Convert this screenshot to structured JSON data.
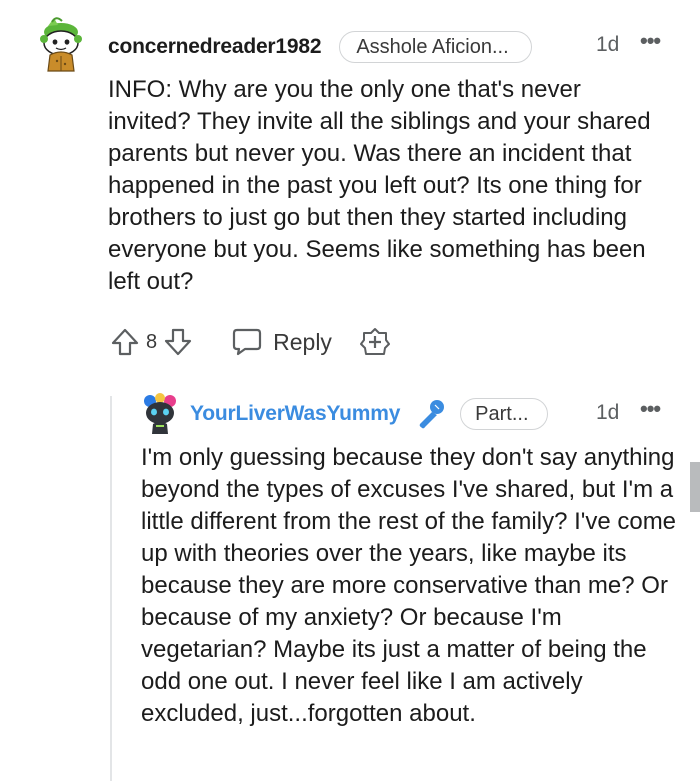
{
  "comment": {
    "username": "concernedreader1982",
    "flair": "Asshole Aficion...",
    "time": "1d",
    "more": "•••",
    "body": "INFO: Why are you the only one that's never invited? They invite all the siblings and your shared parents but never you. Was there an incident that happened in the past you left out? Its one thing for brothers to just go but then they started including everyone but you. Seems like something has been left out?",
    "vote_count": "8",
    "reply_label": "Reply",
    "icons": {
      "avatar": "snoo-avatar-green-hat",
      "upvote": "arrow-up-icon",
      "downvote": "arrow-down-icon",
      "reply": "speech-bubble-icon",
      "award": "award-plus-icon"
    }
  },
  "reply": {
    "username": "YourLiverWasYummy",
    "flair": "Part...",
    "time": "1d",
    "more": "•••",
    "body": "I'm only guessing because they don't say anything beyond the types of excuses I've shared, but I'm a little different from the rest of the family? I've come up with theories over the years, like maybe its because they are more conservative than me? Or because of my anxiety? Or because I'm vegetarian? Maybe its just a matter of being the odd one out. I never feel like I am actively excluded, just...forgotten about.",
    "icons": {
      "avatar": "snoo-avatar-colorful",
      "badge": "microphone-icon"
    }
  },
  "colors": {
    "text": "#1c1c1c",
    "meta": "#5c5f61",
    "op_username": "#3b8ce0",
    "thread_line": "#e3e5e7"
  }
}
